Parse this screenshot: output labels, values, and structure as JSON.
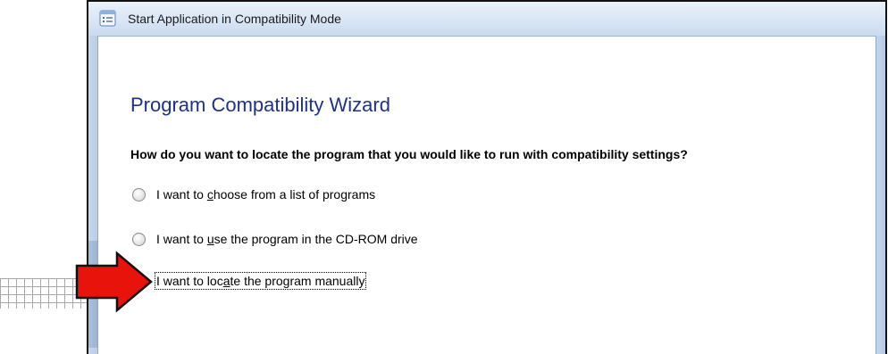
{
  "window": {
    "title": "Start Application in Compatibility Mode"
  },
  "wizard": {
    "heading": "Program Compatibility Wizard",
    "question": "How do you want to locate the program that you would like to run with compatibility settings?",
    "options": [
      {
        "pre": "I want to ",
        "accel": "c",
        "post": "hoose from a list of programs",
        "selected": false
      },
      {
        "pre": "I want to ",
        "accel": "u",
        "post": "se the program in the CD-ROM drive",
        "selected": false
      },
      {
        "pre": "I want to loc",
        "accel": "a",
        "post": "te the program manually",
        "selected": true
      }
    ]
  },
  "colors": {
    "heading": "#1e3287",
    "arrow": "#e8140c",
    "titlebar": "#dce8f6"
  },
  "icons": {
    "app_icon": "list-window-icon",
    "annotation": "red-arrow-icon"
  }
}
